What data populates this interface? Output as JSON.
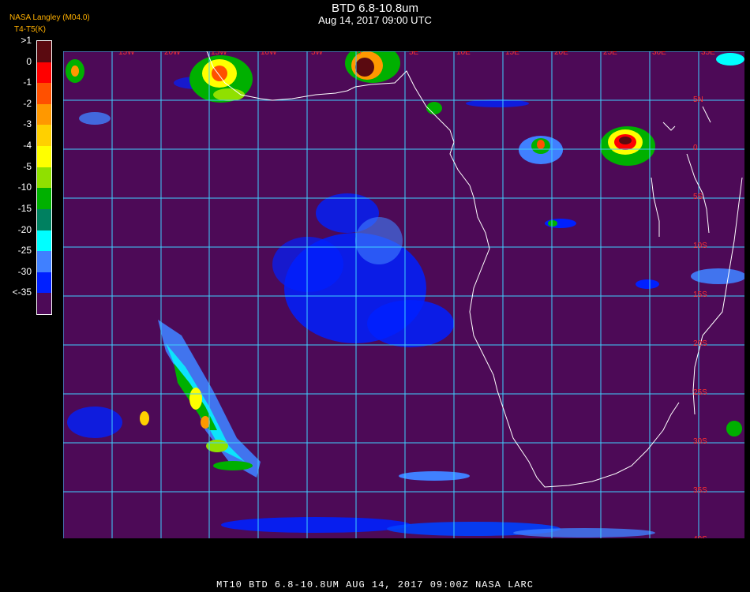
{
  "header": {
    "title": "BTD 6.8-10.8um",
    "subtitle": "Aug 14, 2017 09:00 UTC",
    "credit": "NASA Langley (M04.0)",
    "product": "BTD",
    "units": "T4-T5(K)"
  },
  "legend": {
    "labels": [
      ">1",
      "0",
      "-1",
      "-2",
      "-3",
      "-4",
      "-5",
      "-10",
      "-15",
      "-20",
      "-25",
      "-30",
      "<-35"
    ],
    "colors": [
      "#5a0a10",
      "#ff0000",
      "#ff5000",
      "#ff9800",
      "#ffd000",
      "#ffff00",
      "#90e000",
      "#00b000",
      "#008060",
      "#00ffff",
      "#4080ff",
      "#0020ff",
      "#4d0a57"
    ]
  },
  "map": {
    "background": "#4d0a57",
    "grid_color": "#40d0ff",
    "coast_color": "#ffffff",
    "lon_labels": [
      "15W",
      "20W",
      "15W",
      "10W",
      "5W",
      "0",
      "5E",
      "10E",
      "15E",
      "20E",
      "25E",
      "30E",
      "35E"
    ],
    "lat_labels": [
      "5N",
      "0",
      "5S",
      "10S",
      "15S",
      "20S",
      "25S",
      "30S",
      "35S",
      "40S"
    ]
  },
  "footer": {
    "text": "MT10  BTD 6.8-10.8UM   AUG 14, 2017 09:00Z   NASA LARC"
  }
}
